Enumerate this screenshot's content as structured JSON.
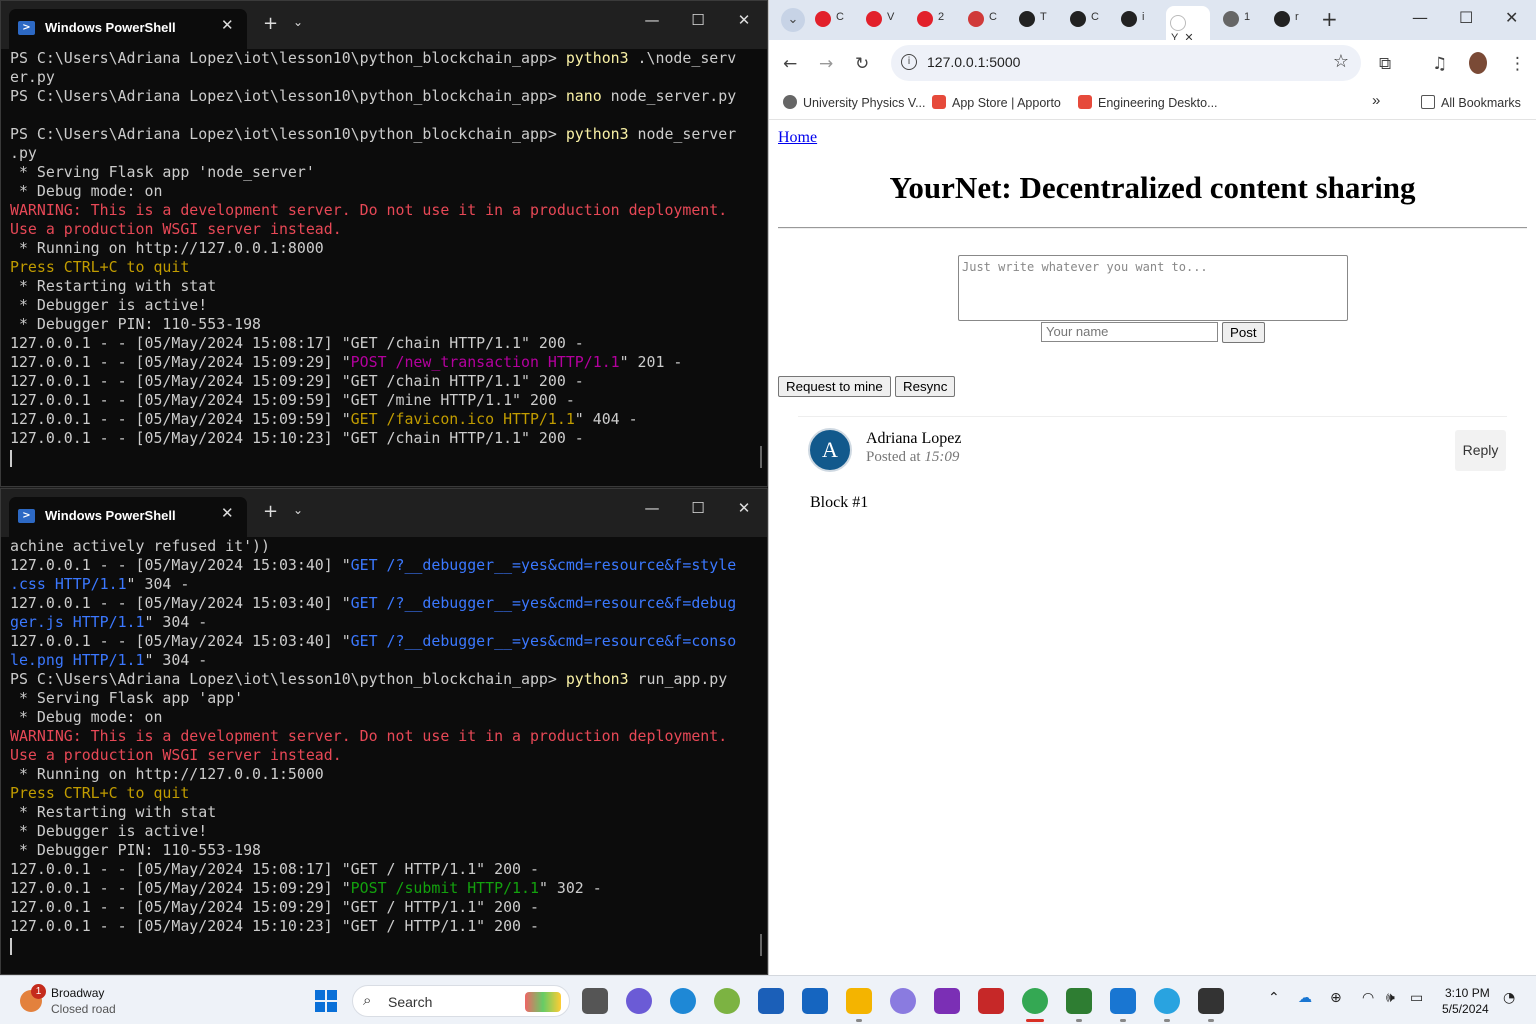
{
  "terminals": [
    {
      "title": "Windows PowerShell",
      "lines": [
        [
          {
            "t": "PS C:\\Users\\Adriana Lopez\\iot\\lesson10\\python_blockchain_app> ",
            "c": "default"
          },
          {
            "t": "python3",
            "c": "yellow"
          },
          {
            "t": " .\\node_serv",
            "c": "default"
          }
        ],
        [
          {
            "t": "er.py",
            "c": "default"
          }
        ],
        [
          {
            "t": "PS C:\\Users\\Adriana Lopez\\iot\\lesson10\\python_blockchain_app> ",
            "c": "default"
          },
          {
            "t": "nano",
            "c": "yellow"
          },
          {
            "t": " node_server.py",
            "c": "default"
          }
        ],
        [
          {
            "t": "",
            "c": "default"
          }
        ],
        [
          {
            "t": "PS C:\\Users\\Adriana Lopez\\iot\\lesson10\\python_blockchain_app> ",
            "c": "default"
          },
          {
            "t": "python3",
            "c": "yellow"
          },
          {
            "t": " node_server",
            "c": "default"
          }
        ],
        [
          {
            "t": ".py",
            "c": "default"
          }
        ],
        [
          {
            "t": " * Serving Flask app 'node_server'",
            "c": "default"
          }
        ],
        [
          {
            "t": " * Debug mode: on",
            "c": "default"
          }
        ],
        [
          {
            "t": "WARNING: This is a development server. Do not use it in a production deployment.",
            "c": "red"
          }
        ],
        [
          {
            "t": "Use a production WSGI server instead.",
            "c": "red"
          }
        ],
        [
          {
            "t": " * Running on http://127.0.0.1:8000",
            "c": "default"
          }
        ],
        [
          {
            "t": "Press CTRL+C to quit",
            "c": "gold"
          }
        ],
        [
          {
            "t": " * Restarting with stat",
            "c": "default"
          }
        ],
        [
          {
            "t": " * Debugger is active!",
            "c": "default"
          }
        ],
        [
          {
            "t": " * Debugger PIN: 110-553-198",
            "c": "default"
          }
        ],
        [
          {
            "t": "127.0.0.1 - - [05/May/2024 15:08:17] \"GET /chain HTTP/1.1\" 200 -",
            "c": "default"
          }
        ],
        [
          {
            "t": "127.0.0.1 - - [05/May/2024 15:09:29] \"",
            "c": "default"
          },
          {
            "t": "POST /new_transaction HTTP/1.1",
            "c": "magenta"
          },
          {
            "t": "\" 201 -",
            "c": "default"
          }
        ],
        [
          {
            "t": "127.0.0.1 - - [05/May/2024 15:09:29] \"GET /chain HTTP/1.1\" 200 -",
            "c": "default"
          }
        ],
        [
          {
            "t": "127.0.0.1 - - [05/May/2024 15:09:59] \"GET /mine HTTP/1.1\" 200 -",
            "c": "default"
          }
        ],
        [
          {
            "t": "127.0.0.1 - - [05/May/2024 15:09:59] \"",
            "c": "default"
          },
          {
            "t": "GET /favicon.ico HTTP/1.1",
            "c": "gold"
          },
          {
            "t": "\" 404 -",
            "c": "default"
          }
        ],
        [
          {
            "t": "127.0.0.1 - - [05/May/2024 15:10:23] \"GET /chain HTTP/1.1\" 200 -",
            "c": "default"
          }
        ]
      ]
    },
    {
      "title": "Windows PowerShell",
      "lines": [
        [
          {
            "t": "achine actively refused it'))",
            "c": "default"
          }
        ],
        [
          {
            "t": "127.0.0.1 - - [05/May/2024 15:03:40] \"",
            "c": "default"
          },
          {
            "t": "GET /?__debugger__=yes&cmd=resource&f=style",
            "c": "blue"
          }
        ],
        [
          {
            "t": ".css HTTP/1.1",
            "c": "blue"
          },
          {
            "t": "\" 304 -",
            "c": "default"
          }
        ],
        [
          {
            "t": "127.0.0.1 - - [05/May/2024 15:03:40] \"",
            "c": "default"
          },
          {
            "t": "GET /?__debugger__=yes&cmd=resource&f=debug",
            "c": "blue"
          }
        ],
        [
          {
            "t": "ger.js HTTP/1.1",
            "c": "blue"
          },
          {
            "t": "\" 304 -",
            "c": "default"
          }
        ],
        [
          {
            "t": "127.0.0.1 - - [05/May/2024 15:03:40] \"",
            "c": "default"
          },
          {
            "t": "GET /?__debugger__=yes&cmd=resource&f=conso",
            "c": "blue"
          }
        ],
        [
          {
            "t": "le.png HTTP/1.1",
            "c": "blue"
          },
          {
            "t": "\" 304 -",
            "c": "default"
          }
        ],
        [
          {
            "t": "PS C:\\Users\\Adriana Lopez\\iot\\lesson10\\python_blockchain_app> ",
            "c": "default"
          },
          {
            "t": "python3",
            "c": "yellow"
          },
          {
            "t": " run_app.py",
            "c": "default"
          }
        ],
        [
          {
            "t": " * Serving Flask app 'app'",
            "c": "default"
          }
        ],
        [
          {
            "t": " * Debug mode: on",
            "c": "default"
          }
        ],
        [
          {
            "t": "WARNING: This is a development server. Do not use it in a production deployment.",
            "c": "red"
          }
        ],
        [
          {
            "t": "Use a production WSGI server instead.",
            "c": "red"
          }
        ],
        [
          {
            "t": " * Running on http://127.0.0.1:5000",
            "c": "default"
          }
        ],
        [
          {
            "t": "Press CTRL+C to quit",
            "c": "gold"
          }
        ],
        [
          {
            "t": " * Restarting with stat",
            "c": "default"
          }
        ],
        [
          {
            "t": " * Debugger is active!",
            "c": "default"
          }
        ],
        [
          {
            "t": " * Debugger PIN: 110-553-198",
            "c": "default"
          }
        ],
        [
          {
            "t": "127.0.0.1 - - [05/May/2024 15:08:17] \"GET / HTTP/1.1\" 200 -",
            "c": "default"
          }
        ],
        [
          {
            "t": "127.0.0.1 - - [05/May/2024 15:09:29] \"",
            "c": "default"
          },
          {
            "t": "POST /submit HTTP/1.1",
            "c": "green"
          },
          {
            "t": "\" 302 -",
            "c": "default"
          }
        ],
        [
          {
            "t": "127.0.0.1 - - [05/May/2024 15:09:29] \"GET / HTTP/1.1\" 200 -",
            "c": "default"
          }
        ],
        [
          {
            "t": "127.0.0.1 - - [05/May/2024 15:10:23] \"GET / HTTP/1.1\" 200 -",
            "c": "default"
          }
        ]
      ]
    }
  ],
  "browser": {
    "tabs": [
      {
        "icon": "opera-icon",
        "label": "C",
        "color": "#e2202b"
      },
      {
        "icon": "opera-icon",
        "label": "V",
        "color": "#e2202b"
      },
      {
        "icon": "opera-icon",
        "label": "2",
        "color": "#e2202b"
      },
      {
        "icon": "app-icon",
        "label": "C",
        "color": "#d03a3a"
      },
      {
        "icon": "github-icon",
        "label": "T",
        "color": "#222222"
      },
      {
        "icon": "github-icon",
        "label": "C",
        "color": "#222222"
      },
      {
        "icon": "github-icon",
        "label": "i",
        "color": "#222222"
      },
      {
        "icon": "page-icon",
        "label": "Y",
        "color": "#ffffff",
        "active": true
      },
      {
        "icon": "globe-icon",
        "label": "1",
        "color": "#666666"
      },
      {
        "icon": "terminal-icon",
        "label": "r",
        "color": "#222222"
      }
    ],
    "url": "127.0.0.1:5000",
    "bookmarks": [
      {
        "label": "University Physics V...",
        "color": "#666666"
      },
      {
        "label": "App Store | Apporto",
        "color": "#e64a3b"
      },
      {
        "label": "Engineering Deskto...",
        "color": "#e64a3b"
      }
    ],
    "all_bookmarks": "All Bookmarks",
    "page": {
      "home_link": "Home",
      "title": "YourNet: Decentralized content sharing",
      "content_placeholder": "Just write whatever you want to...",
      "name_placeholder": "Your name",
      "post_button": "Post",
      "mine_button": "Request to mine",
      "resync_button": "Resync",
      "post": {
        "avatar_letter": "A",
        "author": "Adriana Lopez",
        "posted_prefix": "Posted at",
        "time": "15:09",
        "reply": "Reply",
        "content": "Block #1"
      }
    }
  },
  "taskbar": {
    "weather_badge": "1",
    "weather_title": "Broadway",
    "weather_sub": "Closed road",
    "search_label": "Search",
    "time": "3:10 PM",
    "date": "5/5/2024"
  },
  "colors": {
    "yellow": "#f9f1a5",
    "red": "#e74856",
    "gold": "#c19c00",
    "magenta": "#b4009e",
    "blue": "#3b78ff",
    "green": "#13a10e",
    "default": "#cccccc"
  }
}
